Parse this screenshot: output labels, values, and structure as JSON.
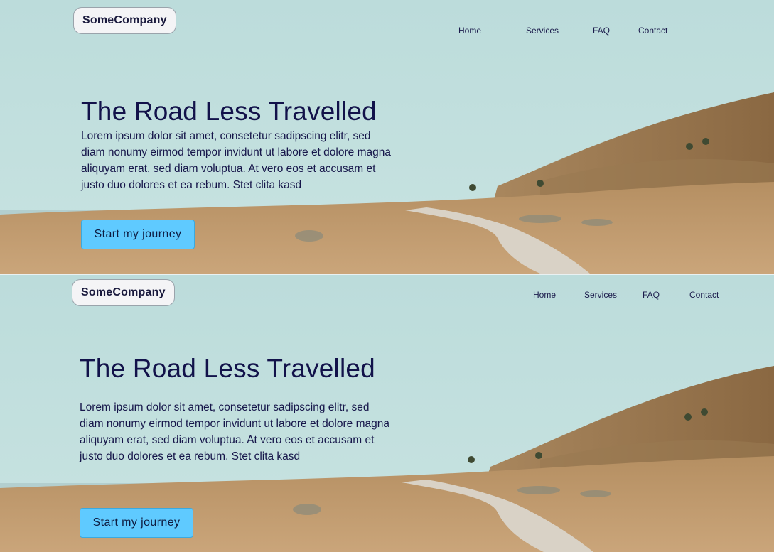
{
  "site": {
    "brand": "SomeCompany",
    "nav": [
      "Home",
      "Services",
      "FAQ",
      "Contact"
    ]
  },
  "hero": {
    "title": "The Road Less Travelled",
    "text": "Lorem ipsum dolor sit amet, consetetur sadipscing elitr, sed diam nonumy eirmod tempor invidunt ut labore et dolore magna aliquyam erat, sed diam voluptua. At vero eos et accusam et justo duo dolores et ea rebum. Stet clita kasd",
    "cta_label": "Start my journey"
  },
  "colors": {
    "sky": "#c3e0e0",
    "title": "#12124a",
    "cta_bg": "#5fcaff",
    "field": "#c89b6a"
  }
}
